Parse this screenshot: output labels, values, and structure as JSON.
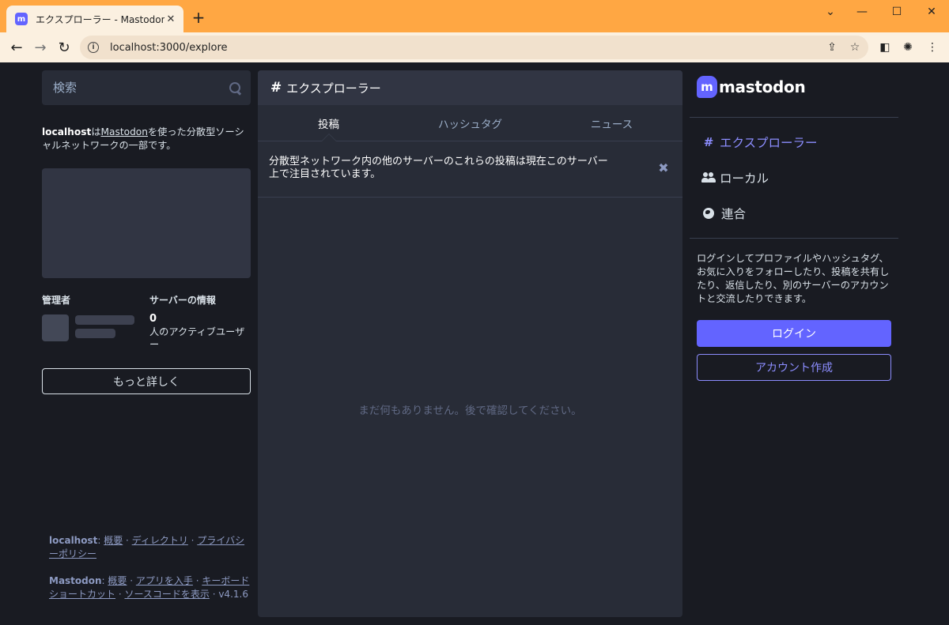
{
  "browser": {
    "tab_title": "エクスプローラー - Mastodon",
    "favicon_letter": "m",
    "url": "localhost:3000/explore",
    "accent_color": "#ffa743"
  },
  "left": {
    "search_placeholder": "検索",
    "about": {
      "server": "localhost",
      "particle": "は",
      "mastodon_link": "Mastodon",
      "rest": "を使った分散型ソーシャルネットワークの一部です。"
    },
    "admin_heading": "管理者",
    "server_info_heading": "サーバーの情報",
    "active_users_count": "0",
    "active_users_label": "人のアクティブユーザー",
    "learn_more_button": "もっと詳しく",
    "footer": {
      "server_name": "localhost",
      "server_links": [
        "概要",
        "ディレクトリ",
        "プライバシーポリシー"
      ],
      "mastodon_name": "Mastodon",
      "mastodon_links": [
        "概要",
        "アプリを入手",
        "キーボードショートカット",
        "ソースコードを表示"
      ],
      "version": "v4.1.6"
    }
  },
  "center": {
    "title": "エクスプローラー",
    "tabs": [
      {
        "label": "投稿",
        "active": true
      },
      {
        "label": "ハッシュタグ",
        "active": false
      },
      {
        "label": "ニュース",
        "active": false
      }
    ],
    "notice": "分散型ネットワーク内の他のサーバーのこれらの投稿は現在このサーバー上で注目されています。",
    "empty_message": "まだ何もありません。後で確認してください。"
  },
  "right": {
    "logo_text": "mastodon",
    "nav": [
      {
        "label": "エクスプローラー",
        "icon": "hash-icon",
        "active": true
      },
      {
        "label": "ローカル",
        "icon": "users-icon",
        "active": false
      },
      {
        "label": "連合",
        "icon": "globe-icon",
        "active": false
      }
    ],
    "signup_text": "ログインしてプロファイルやハッシュタグ、お気に入りをフォローしたり、投稿を共有したり、返信したり、別のサーバーのアカウントと交流したりできます。",
    "login_button": "ログイン",
    "signup_button": "アカウント作成",
    "brand_color": "#6364ff"
  }
}
